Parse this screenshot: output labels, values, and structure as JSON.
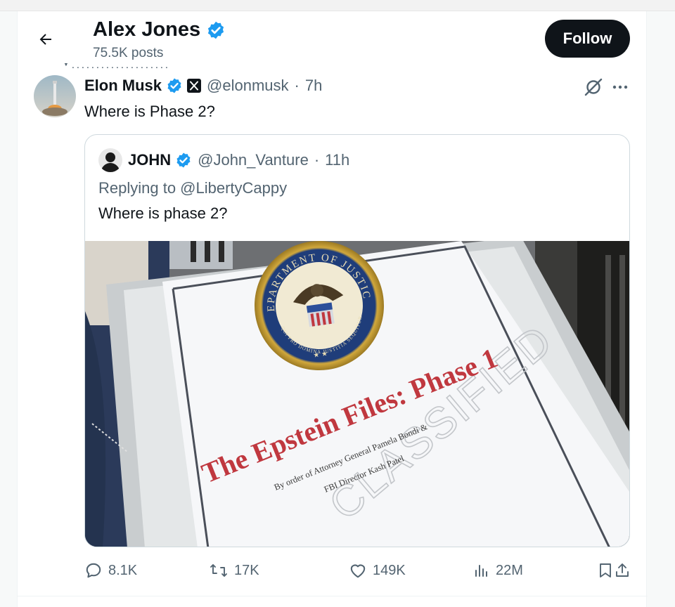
{
  "header": {
    "profile_name": "Alex Jones",
    "posts_count": "75.5K posts",
    "follow_label": "Follow"
  },
  "post": {
    "author_name": "Elon Musk",
    "handle": "@elonmusk",
    "time": "7h",
    "text": "Where is Phase 2?"
  },
  "quote": {
    "author_name": "JOHN",
    "handle": "@John_Vanture",
    "time": "11h",
    "replying_to": "Replying to @LibertyCappy",
    "text": "Where is phase 2?",
    "image": {
      "seal_top_text": "DEPARTMENT OF JUSTICE",
      "seal_bottom_text": "QUI PRO DOMINA JUSTITIA SEQUITUR",
      "stamp": "CLASSIFIED",
      "title": "The Epstein Files: Phase 1",
      "subtitle_line1": "By order of Attorney General Pamela Bondi &",
      "subtitle_line2": "FBI Director Kash Patel"
    }
  },
  "actions": {
    "replies": "8.1K",
    "reposts": "17K",
    "likes": "149K",
    "views": "22M"
  },
  "colors": {
    "verified": "#1d9bf0",
    "text": "#0f1419",
    "muted": "#536471",
    "title_red": "#c0383f"
  }
}
